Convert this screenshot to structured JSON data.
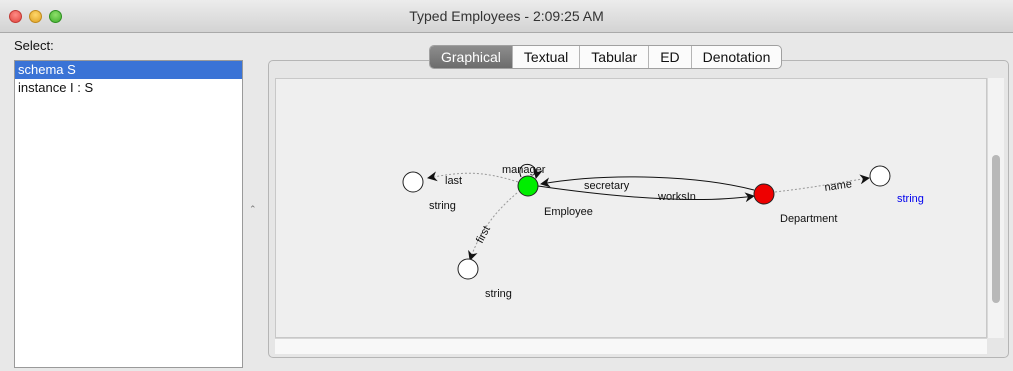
{
  "window": {
    "title": "Typed Employees - 2:09:25 AM"
  },
  "left_panel": {
    "label": "Select:",
    "items": [
      {
        "label": "schema S",
        "selected": true
      },
      {
        "label": "instance I : S",
        "selected": false
      }
    ]
  },
  "splitter": {
    "glyph": "⌃"
  },
  "tabs": [
    {
      "label": "Graphical",
      "active": true
    },
    {
      "label": "Textual",
      "active": false
    },
    {
      "label": "Tabular",
      "active": false
    },
    {
      "label": "ED",
      "active": false
    },
    {
      "label": "Denotation",
      "active": false
    }
  ],
  "graph": {
    "nodes": {
      "employee": {
        "label": "Employee",
        "color": "#00ee00"
      },
      "department": {
        "label": "Department",
        "color": "#ee0000"
      },
      "string_last": {
        "label": "string",
        "color": "#ffffff"
      },
      "string_first": {
        "label": "string",
        "color": "#ffffff"
      },
      "string_name": {
        "label": "string",
        "color": "#ffffff",
        "label_color": "#0000ee"
      },
      "manager_loop": {
        "label": ""
      }
    },
    "edges": {
      "manager": "manager",
      "secretary": "secretary",
      "worksIn": "worksIn",
      "last": "last",
      "first": "first",
      "name": "name"
    }
  }
}
